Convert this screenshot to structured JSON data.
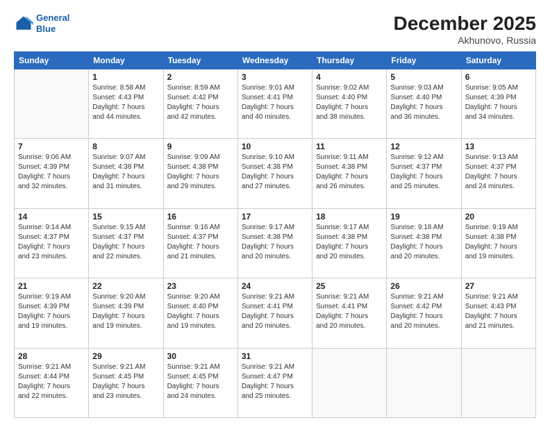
{
  "header": {
    "logo_line1": "General",
    "logo_line2": "Blue",
    "title": "December 2025",
    "subtitle": "Akhunovo, Russia"
  },
  "days_of_week": [
    "Sunday",
    "Monday",
    "Tuesday",
    "Wednesday",
    "Thursday",
    "Friday",
    "Saturday"
  ],
  "weeks": [
    [
      {
        "day": "",
        "info": ""
      },
      {
        "day": "1",
        "info": "Sunrise: 8:58 AM\nSunset: 4:43 PM\nDaylight: 7 hours\nand 44 minutes."
      },
      {
        "day": "2",
        "info": "Sunrise: 8:59 AM\nSunset: 4:42 PM\nDaylight: 7 hours\nand 42 minutes."
      },
      {
        "day": "3",
        "info": "Sunrise: 9:01 AM\nSunset: 4:41 PM\nDaylight: 7 hours\nand 40 minutes."
      },
      {
        "day": "4",
        "info": "Sunrise: 9:02 AM\nSunset: 4:40 PM\nDaylight: 7 hours\nand 38 minutes."
      },
      {
        "day": "5",
        "info": "Sunrise: 9:03 AM\nSunset: 4:40 PM\nDaylight: 7 hours\nand 36 minutes."
      },
      {
        "day": "6",
        "info": "Sunrise: 9:05 AM\nSunset: 4:39 PM\nDaylight: 7 hours\nand 34 minutes."
      }
    ],
    [
      {
        "day": "7",
        "info": "Sunrise: 9:06 AM\nSunset: 4:39 PM\nDaylight: 7 hours\nand 32 minutes."
      },
      {
        "day": "8",
        "info": "Sunrise: 9:07 AM\nSunset: 4:38 PM\nDaylight: 7 hours\nand 31 minutes."
      },
      {
        "day": "9",
        "info": "Sunrise: 9:09 AM\nSunset: 4:38 PM\nDaylight: 7 hours\nand 29 minutes."
      },
      {
        "day": "10",
        "info": "Sunrise: 9:10 AM\nSunset: 4:38 PM\nDaylight: 7 hours\nand 27 minutes."
      },
      {
        "day": "11",
        "info": "Sunrise: 9:11 AM\nSunset: 4:38 PM\nDaylight: 7 hours\nand 26 minutes."
      },
      {
        "day": "12",
        "info": "Sunrise: 9:12 AM\nSunset: 4:37 PM\nDaylight: 7 hours\nand 25 minutes."
      },
      {
        "day": "13",
        "info": "Sunrise: 9:13 AM\nSunset: 4:37 PM\nDaylight: 7 hours\nand 24 minutes."
      }
    ],
    [
      {
        "day": "14",
        "info": "Sunrise: 9:14 AM\nSunset: 4:37 PM\nDaylight: 7 hours\nand 23 minutes."
      },
      {
        "day": "15",
        "info": "Sunrise: 9:15 AM\nSunset: 4:37 PM\nDaylight: 7 hours\nand 22 minutes."
      },
      {
        "day": "16",
        "info": "Sunrise: 9:16 AM\nSunset: 4:37 PM\nDaylight: 7 hours\nand 21 minutes."
      },
      {
        "day": "17",
        "info": "Sunrise: 9:17 AM\nSunset: 4:38 PM\nDaylight: 7 hours\nand 20 minutes."
      },
      {
        "day": "18",
        "info": "Sunrise: 9:17 AM\nSunset: 4:38 PM\nDaylight: 7 hours\nand 20 minutes."
      },
      {
        "day": "19",
        "info": "Sunrise: 9:18 AM\nSunset: 4:38 PM\nDaylight: 7 hours\nand 20 minutes."
      },
      {
        "day": "20",
        "info": "Sunrise: 9:19 AM\nSunset: 4:38 PM\nDaylight: 7 hours\nand 19 minutes."
      }
    ],
    [
      {
        "day": "21",
        "info": "Sunrise: 9:19 AM\nSunset: 4:39 PM\nDaylight: 7 hours\nand 19 minutes."
      },
      {
        "day": "22",
        "info": "Sunrise: 9:20 AM\nSunset: 4:39 PM\nDaylight: 7 hours\nand 19 minutes."
      },
      {
        "day": "23",
        "info": "Sunrise: 9:20 AM\nSunset: 4:40 PM\nDaylight: 7 hours\nand 19 minutes."
      },
      {
        "day": "24",
        "info": "Sunrise: 9:21 AM\nSunset: 4:41 PM\nDaylight: 7 hours\nand 20 minutes."
      },
      {
        "day": "25",
        "info": "Sunrise: 9:21 AM\nSunset: 4:41 PM\nDaylight: 7 hours\nand 20 minutes."
      },
      {
        "day": "26",
        "info": "Sunrise: 9:21 AM\nSunset: 4:42 PM\nDaylight: 7 hours\nand 20 minutes."
      },
      {
        "day": "27",
        "info": "Sunrise: 9:21 AM\nSunset: 4:43 PM\nDaylight: 7 hours\nand 21 minutes."
      }
    ],
    [
      {
        "day": "28",
        "info": "Sunrise: 9:21 AM\nSunset: 4:44 PM\nDaylight: 7 hours\nand 22 minutes."
      },
      {
        "day": "29",
        "info": "Sunrise: 9:21 AM\nSunset: 4:45 PM\nDaylight: 7 hours\nand 23 minutes."
      },
      {
        "day": "30",
        "info": "Sunrise: 9:21 AM\nSunset: 4:45 PM\nDaylight: 7 hours\nand 24 minutes."
      },
      {
        "day": "31",
        "info": "Sunrise: 9:21 AM\nSunset: 4:47 PM\nDaylight: 7 hours\nand 25 minutes."
      },
      {
        "day": "",
        "info": ""
      },
      {
        "day": "",
        "info": ""
      },
      {
        "day": "",
        "info": ""
      }
    ]
  ]
}
